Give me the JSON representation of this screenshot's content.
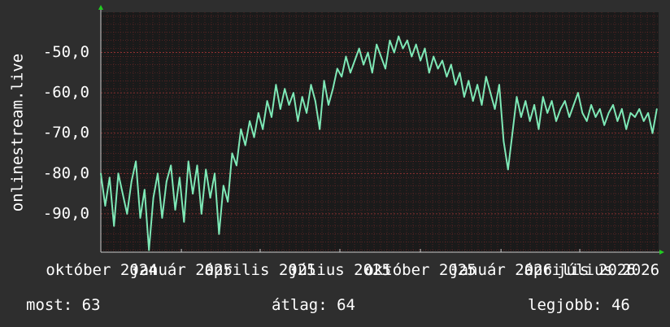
{
  "chart_data": {
    "type": "line",
    "ylabel": "onlinestream.live",
    "yticks": [
      -50,
      -60,
      -70,
      -80,
      -90
    ],
    "ytick_labels": [
      "-50,0",
      "-60,0",
      "-70,0",
      "-80,0",
      "-90,0"
    ],
    "ylim": [
      -99.5,
      -40
    ],
    "xlim": [
      "2024-10-01",
      "2026-06-30"
    ],
    "xticks": [
      {
        "date": "2024-10-01",
        "label": "október 2024"
      },
      {
        "date": "2025-01-01",
        "label": "január 2025"
      },
      {
        "date": "2025-04-01",
        "label": "április 2025"
      },
      {
        "date": "2025-07-01",
        "label": "július 2025"
      },
      {
        "date": "2025-10-01",
        "label": "október 2025"
      },
      {
        "date": "2026-01-01",
        "label": "január 2026"
      },
      {
        "date": "2026-04-01",
        "label": "április 2026"
      },
      {
        "date": "2026-07-01",
        "label": "július 2026"
      }
    ],
    "grid": true,
    "series": [
      {
        "color": "#7ee8b6",
        "points": [
          [
            "2024-10-01",
            -80
          ],
          [
            "2024-10-06",
            -88
          ],
          [
            "2024-10-11",
            -81
          ],
          [
            "2024-10-16",
            -93
          ],
          [
            "2024-10-21",
            -80
          ],
          [
            "2024-10-26",
            -85
          ],
          [
            "2024-10-31",
            -90
          ],
          [
            "2024-11-05",
            -82
          ],
          [
            "2024-11-10",
            -77
          ],
          [
            "2024-11-15",
            -91
          ],
          [
            "2024-11-20",
            -84
          ],
          [
            "2024-11-25",
            -99
          ],
          [
            "2024-11-30",
            -86
          ],
          [
            "2024-12-05",
            -80
          ],
          [
            "2024-12-10",
            -91
          ],
          [
            "2024-12-15",
            -82
          ],
          [
            "2024-12-20",
            -78
          ],
          [
            "2024-12-25",
            -89
          ],
          [
            "2024-12-30",
            -81
          ],
          [
            "2025-01-04",
            -92
          ],
          [
            "2025-01-09",
            -77
          ],
          [
            "2025-01-14",
            -85
          ],
          [
            "2025-01-19",
            -78
          ],
          [
            "2025-01-24",
            -90
          ],
          [
            "2025-01-29",
            -79
          ],
          [
            "2025-02-03",
            -86
          ],
          [
            "2025-02-08",
            -80
          ],
          [
            "2025-02-13",
            -95
          ],
          [
            "2025-02-18",
            -83
          ],
          [
            "2025-02-23",
            -87
          ],
          [
            "2025-02-28",
            -75
          ],
          [
            "2025-03-05",
            -78
          ],
          [
            "2025-03-10",
            -69
          ],
          [
            "2025-03-15",
            -73
          ],
          [
            "2025-03-20",
            -67
          ],
          [
            "2025-03-25",
            -71
          ],
          [
            "2025-03-30",
            -65
          ],
          [
            "2025-04-04",
            -69
          ],
          [
            "2025-04-09",
            -62
          ],
          [
            "2025-04-14",
            -66
          ],
          [
            "2025-04-19",
            -58
          ],
          [
            "2025-04-24",
            -64
          ],
          [
            "2025-04-29",
            -59
          ],
          [
            "2025-05-04",
            -63
          ],
          [
            "2025-05-09",
            -60
          ],
          [
            "2025-05-14",
            -67
          ],
          [
            "2025-05-19",
            -61
          ],
          [
            "2025-05-24",
            -65
          ],
          [
            "2025-05-29",
            -58
          ],
          [
            "2025-06-03",
            -62
          ],
          [
            "2025-06-08",
            -69
          ],
          [
            "2025-06-13",
            -57
          ],
          [
            "2025-06-18",
            -63
          ],
          [
            "2025-06-23",
            -59
          ],
          [
            "2025-06-28",
            -54
          ],
          [
            "2025-07-03",
            -56
          ],
          [
            "2025-07-08",
            -51
          ],
          [
            "2025-07-13",
            -55
          ],
          [
            "2025-07-18",
            -52
          ],
          [
            "2025-07-23",
            -49
          ],
          [
            "2025-07-28",
            -53
          ],
          [
            "2025-08-02",
            -50
          ],
          [
            "2025-08-07",
            -55
          ],
          [
            "2025-08-12",
            -48
          ],
          [
            "2025-08-17",
            -51
          ],
          [
            "2025-08-22",
            -54
          ],
          [
            "2025-08-27",
            -47
          ],
          [
            "2025-09-01",
            -50
          ],
          [
            "2025-09-06",
            -46
          ],
          [
            "2025-09-11",
            -49
          ],
          [
            "2025-09-16",
            -47
          ],
          [
            "2025-09-21",
            -51
          ],
          [
            "2025-09-26",
            -48
          ],
          [
            "2025-10-01",
            -52
          ],
          [
            "2025-10-06",
            -49
          ],
          [
            "2025-10-11",
            -55
          ],
          [
            "2025-10-16",
            -51
          ],
          [
            "2025-10-21",
            -54
          ],
          [
            "2025-10-26",
            -52
          ],
          [
            "2025-10-31",
            -56
          ],
          [
            "2025-11-05",
            -53
          ],
          [
            "2025-11-10",
            -58
          ],
          [
            "2025-11-15",
            -55
          ],
          [
            "2025-11-20",
            -61
          ],
          [
            "2025-11-25",
            -57
          ],
          [
            "2025-11-30",
            -62
          ],
          [
            "2025-12-05",
            -58
          ],
          [
            "2025-12-10",
            -63
          ],
          [
            "2025-12-15",
            -56
          ],
          [
            "2025-12-20",
            -60
          ],
          [
            "2025-12-25",
            -64
          ],
          [
            "2025-12-30",
            -58
          ],
          [
            "2026-01-04",
            -72
          ],
          [
            "2026-01-09",
            -79
          ],
          [
            "2026-01-14",
            -70
          ],
          [
            "2026-01-19",
            -61
          ],
          [
            "2026-01-24",
            -66
          ],
          [
            "2026-01-29",
            -62
          ],
          [
            "2026-02-03",
            -67
          ],
          [
            "2026-02-08",
            -63
          ],
          [
            "2026-02-13",
            -69
          ],
          [
            "2026-02-18",
            -61
          ],
          [
            "2026-02-23",
            -65
          ],
          [
            "2026-02-28",
            -62
          ],
          [
            "2026-03-05",
            -67
          ],
          [
            "2026-03-10",
            -64
          ],
          [
            "2026-03-15",
            -62
          ],
          [
            "2026-03-20",
            -66
          ],
          [
            "2026-03-25",
            -63
          ],
          [
            "2026-03-30",
            -60
          ],
          [
            "2026-04-04",
            -65
          ],
          [
            "2026-04-09",
            -67
          ],
          [
            "2026-04-14",
            -63
          ],
          [
            "2026-04-19",
            -66
          ],
          [
            "2026-04-24",
            -64
          ],
          [
            "2026-04-29",
            -68
          ],
          [
            "2026-05-04",
            -65
          ],
          [
            "2026-05-09",
            -63
          ],
          [
            "2026-05-14",
            -67
          ],
          [
            "2026-05-19",
            -64
          ],
          [
            "2026-05-24",
            -69
          ],
          [
            "2026-05-29",
            -65
          ],
          [
            "2026-06-03",
            -66
          ],
          [
            "2026-06-08",
            -64
          ],
          [
            "2026-06-13",
            -67
          ],
          [
            "2026-06-18",
            -65
          ],
          [
            "2026-06-23",
            -70
          ],
          [
            "2026-06-28",
            -64
          ]
        ]
      }
    ]
  },
  "footer": {
    "current": "most: 63",
    "average": "átlag: 64",
    "best": "legjobb: 46"
  },
  "colors": {
    "background": "#2e2e2e",
    "plot_background": "#1a1a1a",
    "grid": "#7a2a2a",
    "line": "#7ee8b6",
    "axis_arrow": "#22cc22",
    "text": "#ffffff"
  }
}
